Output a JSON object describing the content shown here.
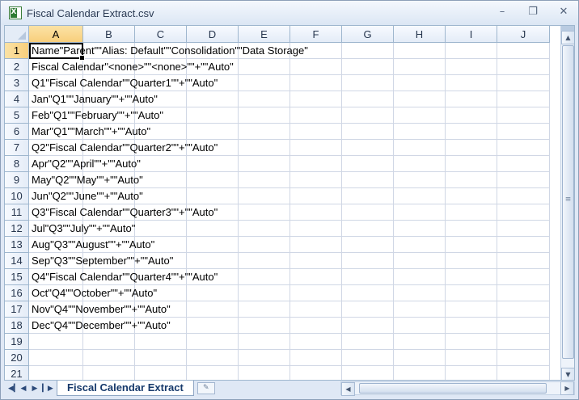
{
  "window": {
    "title": "Fiscal Calendar Extract.csv",
    "minimize_icon": "minimize-icon",
    "restore_icon": "restore-icon",
    "close_icon": "close-icon"
  },
  "columns": [
    "A",
    "B",
    "C",
    "D",
    "E",
    "F",
    "G",
    "H",
    "I",
    "J"
  ],
  "rows": [
    {
      "n": "1",
      "text": "Name\"Parent\"\"Alias: Default\"\"Consolidation\"\"Data Storage\""
    },
    {
      "n": "2",
      "text": "Fiscal Calendar\"<none>\"\"<none>\"\"+\"\"Auto\""
    },
    {
      "n": "3",
      "text": "Q1\"Fiscal Calendar\"\"Quarter1\"\"+\"\"Auto\""
    },
    {
      "n": "4",
      "text": "Jan\"Q1\"\"January\"\"+\"\"Auto\""
    },
    {
      "n": "5",
      "text": "Feb\"Q1\"\"February\"\"+\"\"Auto\""
    },
    {
      "n": "6",
      "text": "Mar\"Q1\"\"March\"\"+\"\"Auto\""
    },
    {
      "n": "7",
      "text": "Q2\"Fiscal Calendar\"\"Quarter2\"\"+\"\"Auto\""
    },
    {
      "n": "8",
      "text": "Apr\"Q2\"\"April\"\"+\"\"Auto\""
    },
    {
      "n": "9",
      "text": "May\"Q2\"\"May\"\"+\"\"Auto\""
    },
    {
      "n": "10",
      "text": "Jun\"Q2\"\"June\"\"+\"\"Auto\""
    },
    {
      "n": "11",
      "text": "Q3\"Fiscal Calendar\"\"Quarter3\"\"+\"\"Auto\""
    },
    {
      "n": "12",
      "text": "Jul\"Q3\"\"July\"\"+\"\"Auto\""
    },
    {
      "n": "13",
      "text": "Aug\"Q3\"\"August\"\"+\"\"Auto\""
    },
    {
      "n": "14",
      "text": "Sep\"Q3\"\"September\"\"+\"\"Auto\""
    },
    {
      "n": "15",
      "text": "Q4\"Fiscal Calendar\"\"Quarter4\"\"+\"\"Auto\""
    },
    {
      "n": "16",
      "text": "Oct\"Q4\"\"October\"\"+\"\"Auto\""
    },
    {
      "n": "17",
      "text": "Nov\"Q4\"\"November\"\"+\"\"Auto\""
    },
    {
      "n": "18",
      "text": "Dec\"Q4\"\"December\"\"+\"\"Auto\""
    },
    {
      "n": "19",
      "text": ""
    },
    {
      "n": "20",
      "text": ""
    },
    {
      "n": "21",
      "text": ""
    }
  ],
  "selected": {
    "column": "A",
    "row": "1"
  },
  "sheet_tabs": [
    "Fiscal Calendar Extract"
  ]
}
